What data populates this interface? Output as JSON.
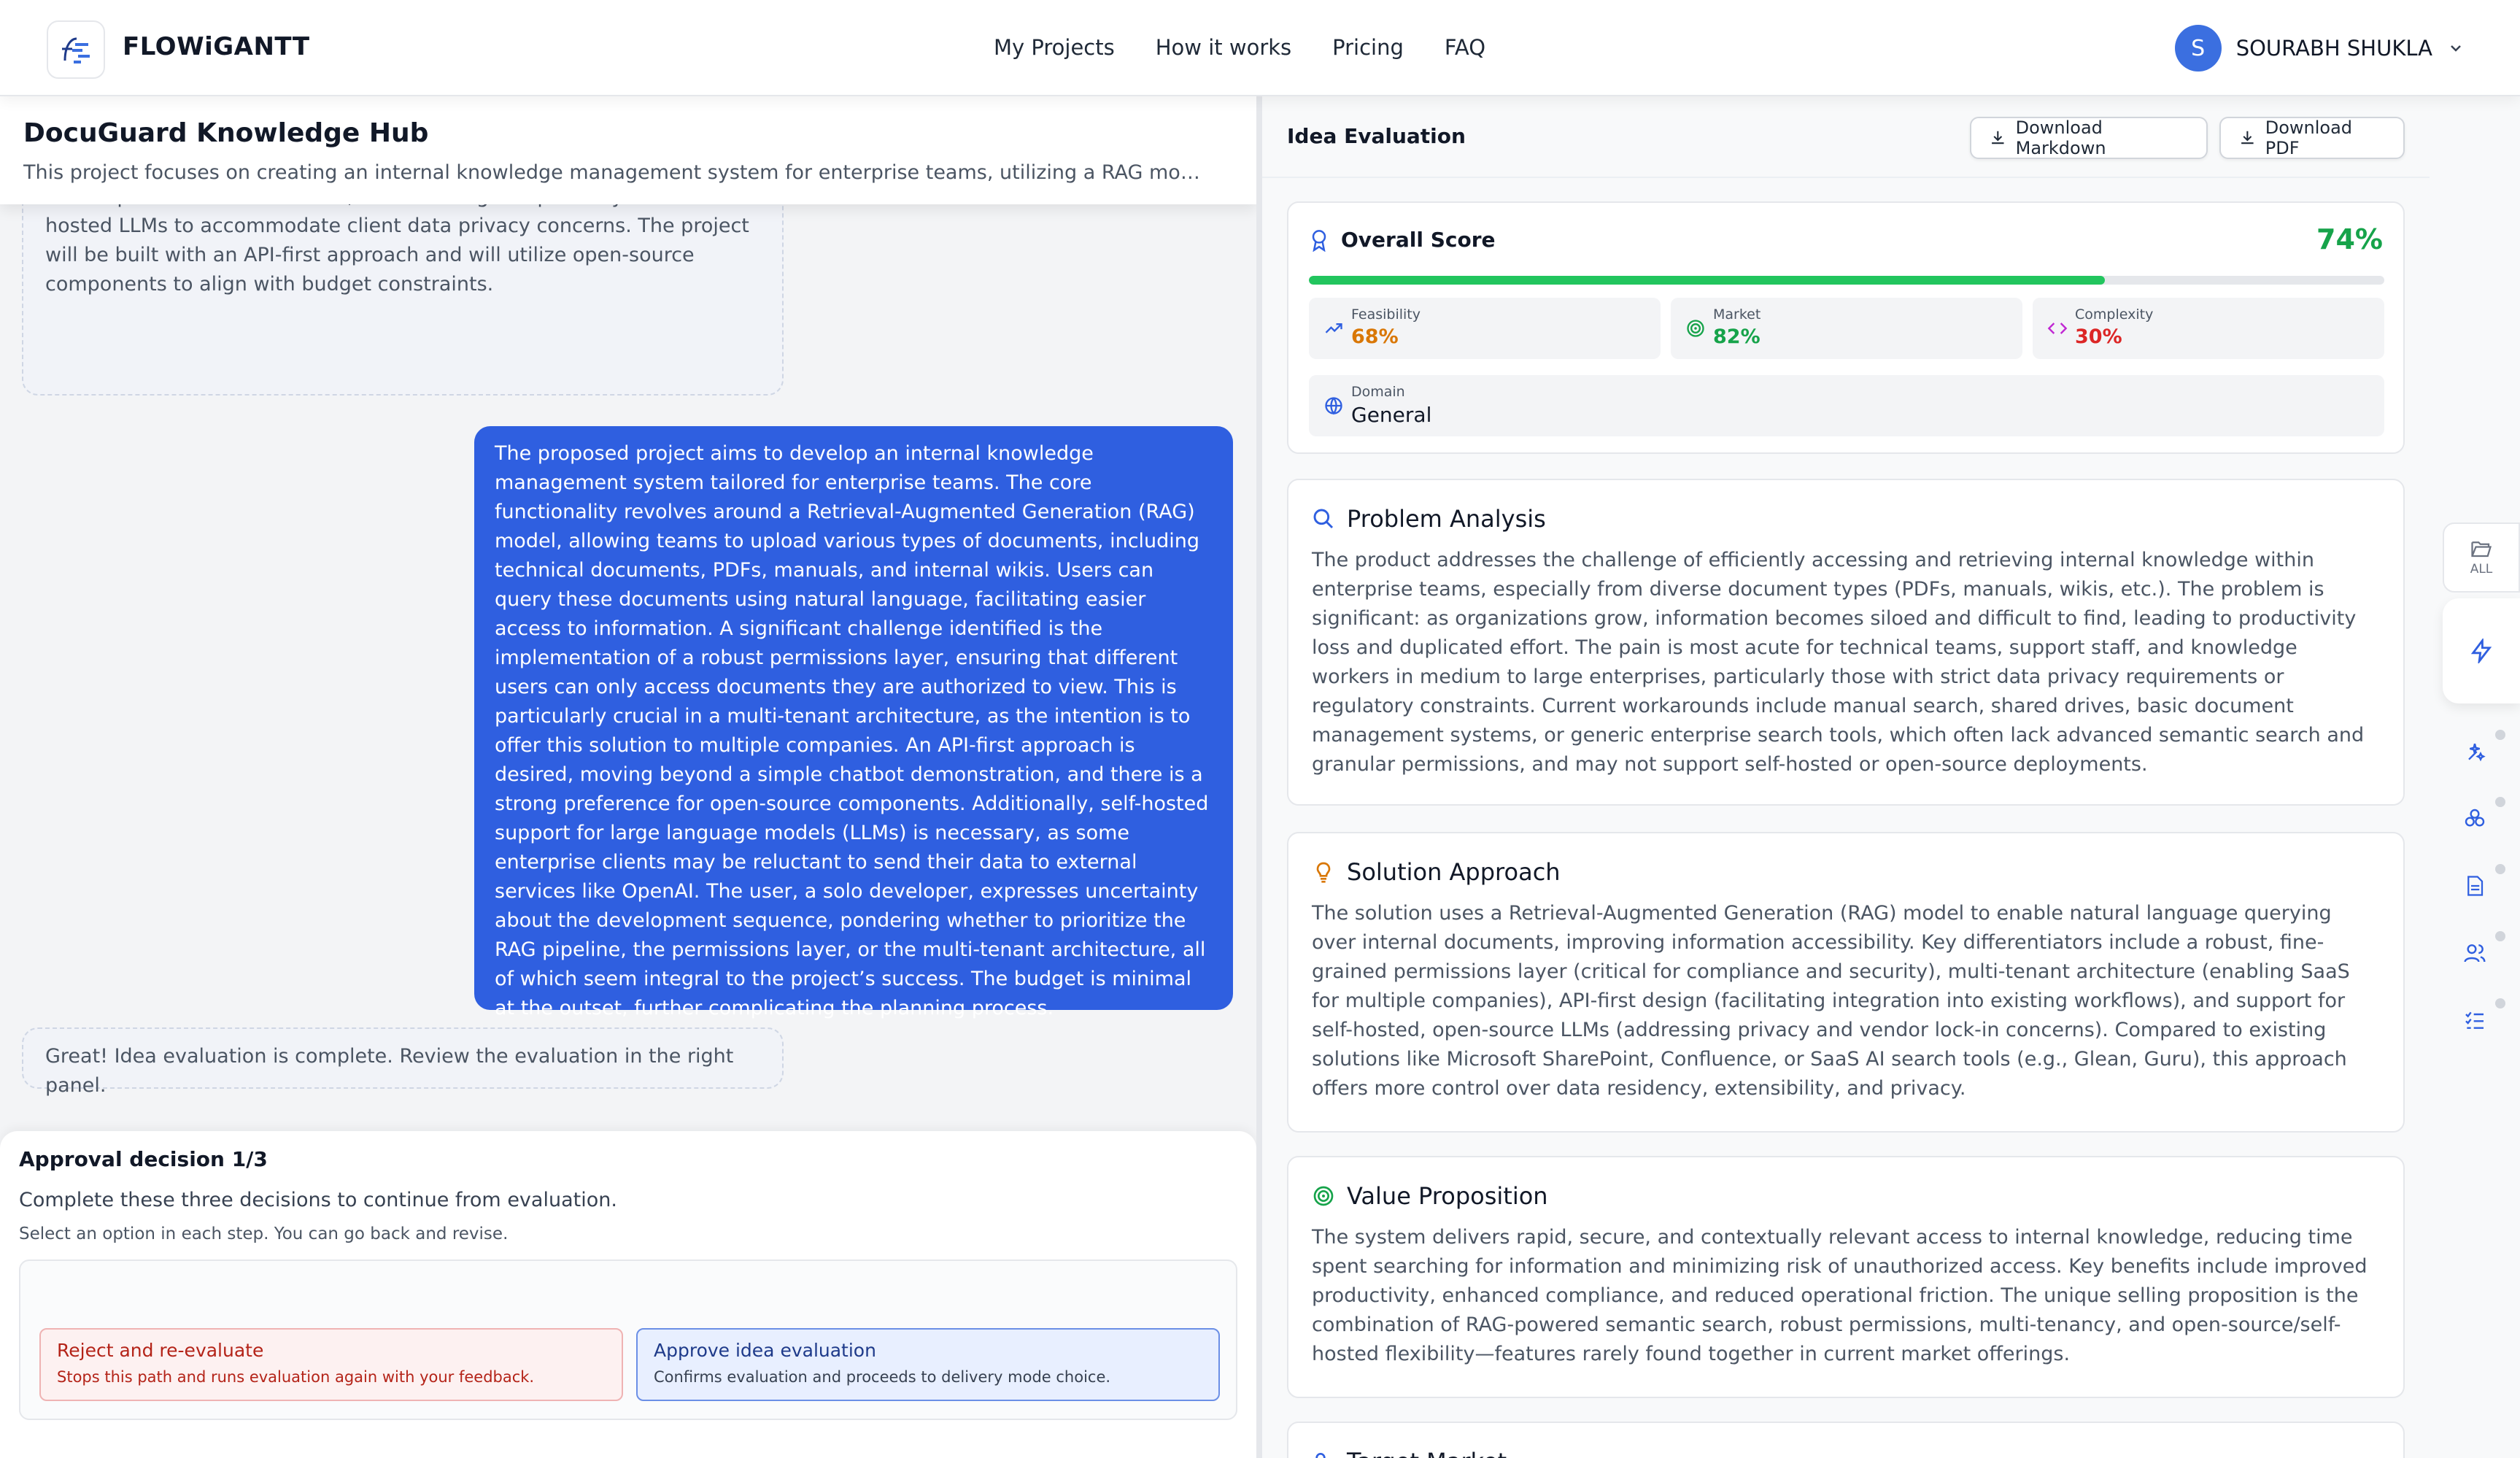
{
  "header": {
    "brand": "FLOWiGANTT",
    "nav": [
      "My Projects",
      "How it works",
      "Pricing",
      "FAQ"
    ],
    "user": {
      "initial": "S",
      "name": "SOURABH SHUKLA"
    }
  },
  "project": {
    "title": "DocuGuard Knowledge Hub",
    "description": "This project focuses on creating an internal knowledge management system for enterprise teams, utilizing a RAG model for..."
  },
  "chat": {
    "ai_partial": "access based on user roles. Additionally, it will support multi-tenant architecture, enabling deployment across various organizations. Key technical challenges include developing the RAG pipeline, establishing a secure permissions framework, and ensuring compatibility with self-hosted LLMs to accommodate client data privacy concerns. The project will be built with an API-first approach and will utilize open-source components to align with budget constraints.",
    "user_message": "The proposed project aims to develop an internal knowledge management system tailored for enterprise teams. The core functionality revolves around a Retrieval-Augmented Generation (RAG) model, allowing teams to upload various types of documents, including technical documents, PDFs, manuals, and internal wikis. Users can query these documents using natural language, facilitating easier access to information. A significant challenge identified is the implementation of a robust permissions layer, ensuring that different users can only access documents they are authorized to view. This is particularly crucial in a multi-tenant architecture, as the intention is to offer this solution to multiple companies. An API-first approach is desired, moving beyond a simple chatbot demonstration, and there is a strong preference for open-source components. Additionally, self-hosted support for large language models (LLMs) is necessary, as some enterprise clients may be reluctant to send their data to external services like OpenAI. The user, a solo developer, expresses uncertainty about the development sequence, pondering whether to prioritize the RAG pipeline, the permissions layer, or the multi-tenant architecture, all of which seem integral to the project’s success. The budget is minimal at the outset, further complicating the planning process.",
    "ai_done": "Great! Idea evaluation is complete. Review the evaluation in the right panel."
  },
  "approval": {
    "title": "Approval decision 1/3",
    "subtitle": "Complete these three decisions to continue from evaluation.",
    "hint": "Select an option in each step. You can go back and revise.",
    "reject": {
      "label": "Reject and re-evaluate",
      "desc": "Stops this path and runs evaluation again with your feedback."
    },
    "approve": {
      "label": "Approve idea evaluation",
      "desc": "Confirms evaluation and proceeds to delivery mode choice."
    }
  },
  "evaluation": {
    "title": "Idea Evaluation",
    "download_markdown": "Download Markdown",
    "download_pdf": "Download PDF",
    "overall_label": "Overall Score",
    "overall_value": "74%",
    "overall_fraction": 0.74,
    "metrics": [
      {
        "label": "Feasibility",
        "value": "68%",
        "color": "#d97706"
      },
      {
        "label": "Market",
        "value": "82%",
        "color": "#16a34a"
      },
      {
        "label": "Complexity",
        "value": "30%",
        "color": "#dc2626"
      }
    ],
    "domain_label": "Domain",
    "domain_value": "General",
    "sections": [
      {
        "title": "Problem Analysis",
        "icon": "search-icon",
        "body": "The product addresses the challenge of efficiently accessing and retrieving internal knowledge within enterprise teams, especially from diverse document types (PDFs, manuals, wikis, etc.). The problem is significant: as organizations grow, information becomes siloed and difficult to find, leading to productivity loss and duplicated effort. The pain is most acute for technical teams, support staff, and knowledge workers in medium to large enterprises, particularly those with strict data privacy requirements or regulatory constraints. Current workarounds include manual search, shared drives, basic document management systems, or generic enterprise search tools, which often lack advanced semantic search and granular permissions, and may not support self-hosted or open-source deployments."
      },
      {
        "title": "Solution Approach",
        "icon": "lightbulb-icon",
        "body": "The solution uses a Retrieval-Augmented Generation (RAG) model to enable natural language querying over internal documents, improving information accessibility. Key differentiators include a robust, fine-grained permissions layer (critical for compliance and security), multi-tenant architecture (enabling SaaS for multiple companies), API-first design (facilitating integration into existing workflows), and support for self-hosted, open-source LLMs (addressing privacy and vendor lock-in concerns). Compared to existing solutions like Microsoft SharePoint, Confluence, or SaaS AI search tools (e.g., Glean, Guru), this approach offers more control over data residency, extensibility, and privacy."
      },
      {
        "title": "Value Proposition",
        "icon": "target-icon",
        "body": "The system delivers rapid, secure, and contextually relevant access to internal knowledge, reducing time spent searching for information and minimizing risk of unauthorized access. Key benefits include improved productivity, enhanced compliance, and reduced operational friction. The unique selling proposition is the combination of RAG-powered semantic search, robust permissions, multi-tenancy, and open-source/self-hosted flexibility—features rarely found together in current market offerings."
      },
      {
        "title": "Target Market",
        "icon": "users-icon",
        "body": ""
      }
    ]
  },
  "rail": {
    "all_label": "ALL"
  }
}
